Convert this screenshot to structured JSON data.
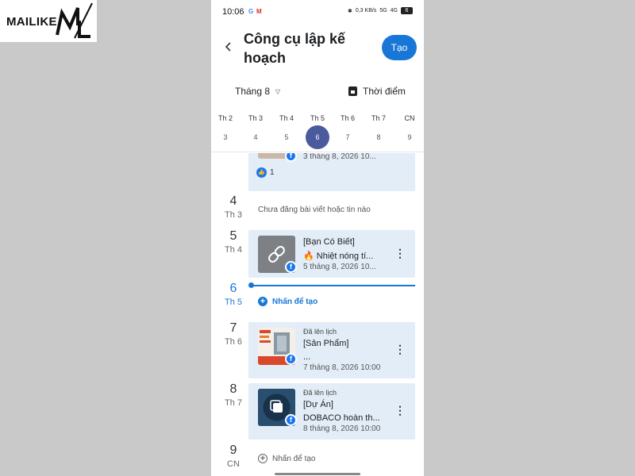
{
  "logo": {
    "text": "MAILIKE"
  },
  "status_bar": {
    "time": "10:06",
    "g": "G",
    "m": "M",
    "net": "0,3 KB/s",
    "sig": "5G",
    "sig2": "4G",
    "battery": "6"
  },
  "header": {
    "title": "Công cụ lập kế hoạch",
    "create_label": "Tạo"
  },
  "toolbar": {
    "month": "Tháng 8",
    "moment": "Thời điểm"
  },
  "week": [
    {
      "name": "Th 2",
      "num": "3"
    },
    {
      "name": "Th 3",
      "num": "4"
    },
    {
      "name": "Th 4",
      "num": "5"
    },
    {
      "name": "Th 5",
      "num": "6"
    },
    {
      "name": "Th 6",
      "num": "7"
    },
    {
      "name": "Th 7",
      "num": "8"
    },
    {
      "name": "CN",
      "num": "9"
    }
  ],
  "feed": {
    "top_card": {
      "date": "3 tháng 8, 2026 10...",
      "likes": "1"
    },
    "day4": {
      "num": "4",
      "wd": "Th 3",
      "empty": "Chưa đăng bài viết hoặc tin nào"
    },
    "day5": {
      "num": "5",
      "wd": "Th 4",
      "tag": "[Bạn Có Biết]",
      "text": "🔥 Nhiệt nóng tí...",
      "date": "5 tháng 8, 2026 10..."
    },
    "day6": {
      "num": "6",
      "wd": "Th 5",
      "tap": "Nhấn để tạo"
    },
    "day7": {
      "num": "7",
      "wd": "Th 6",
      "status": "Đã lên lịch",
      "tag": "[Sản Phẩm]",
      "text": "...",
      "date": "7 tháng 8, 2026 10:00"
    },
    "day8": {
      "num": "8",
      "wd": "Th 7",
      "status": "Đã lên lịch",
      "tag": "[Dự Án]",
      "text": "DOBACO hoàn th...",
      "date": "8 tháng 8, 2026 10:00"
    },
    "day9": {
      "num": "9",
      "wd": "CN",
      "tap": "Nhấn để tạo"
    }
  },
  "colors": {
    "accent": "#1877d6",
    "card_bg": "#e3edf7",
    "selected_day": "#4a5a9c",
    "facebook": "#1877f2"
  }
}
